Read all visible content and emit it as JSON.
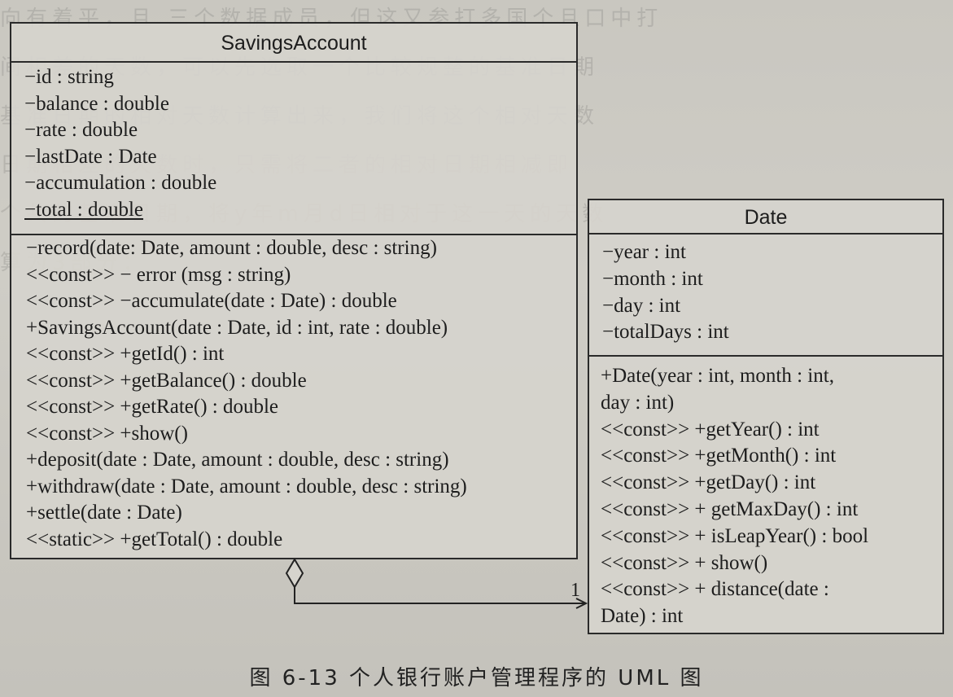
{
  "diagram": {
    "savings_account": {
      "name": "SavingsAccount",
      "attributes": [
        "−id : string",
        "−balance : double",
        "−rate : double",
        "−lastDate : Date",
        "−accumulation : double",
        "−total : double"
      ],
      "operations": [
        "−record(date: Date, amount : double, desc : string)",
        "<<const>> − error (msg : string)",
        "<<const>> −accumulate(date : Date) : double",
        "+SavingsAccount(date : Date, id : int, rate : double)",
        "<<const>> +getId() : int",
        "<<const>> +getBalance() : double",
        "<<const>> +getRate() : double",
        "<<const>> +show()",
        "+deposit(date : Date, amount : double, desc : string)",
        "+withdraw(date : Date, amount : double, desc : string)",
        "+settle(date : Date)",
        "<<static>> +getTotal() : double"
      ]
    },
    "date": {
      "name": "Date",
      "attributes": [
        "−year : int",
        "−month : int",
        "−day : int",
        "−totalDays : int"
      ],
      "operations": [
        "+Date(year : int, month : int,",
        "day : int)",
        "<<const>> +getYear() : int",
        "<<const>> +getMonth() : int",
        "<<const>> +getDay() : int",
        "<<const>> + getMaxDay() : int",
        "<<const>> + isLeapYear() : bool",
        "<<const>> + show()",
        "<<const>> + distance(date :",
        "Date) : int"
      ]
    },
    "association": {
      "multiplicity": "1"
    }
  },
  "caption": "图 6-13   个人银行账户管理程序的 UML 图"
}
